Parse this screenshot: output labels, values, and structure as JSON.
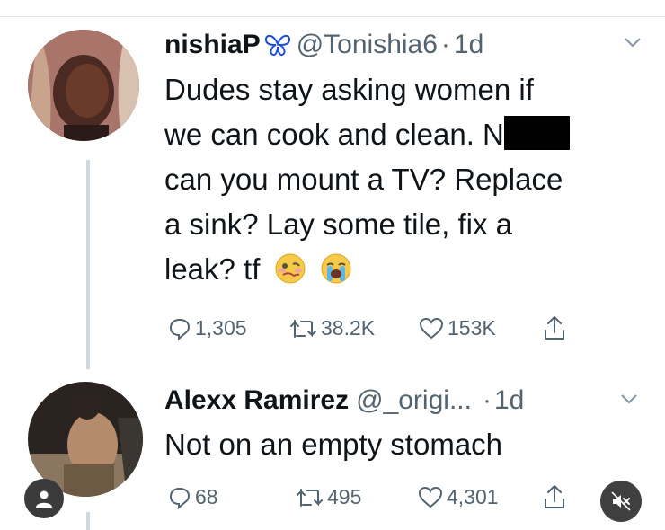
{
  "tweet1": {
    "display_name": "nishiaP",
    "handle": "@Tonishia6",
    "dot": "·",
    "time": "1d",
    "text_lines": [
      "Dudes stay asking women if",
      "we can cook and clean. N",
      "can you mount a TV? Replace",
      "a sink? Lay some tile, fix a",
      "leak? tf"
    ],
    "emojis": [
      "woozy-face",
      "loudly-crying-face"
    ],
    "replies": "1,305",
    "retweets": "38.2K",
    "likes": "153K"
  },
  "tweet2": {
    "display_name": "Alexx Ramirez",
    "handle": "@_origi...",
    "dot": "·",
    "time": "1d",
    "text": "Not on an empty stomach",
    "replies": "68",
    "retweets": "495",
    "likes": "4,301"
  },
  "icons": {
    "reply": "reply-icon",
    "retweet": "retweet-icon",
    "like": "heart-icon",
    "share": "share-icon",
    "more": "chevron-down-icon",
    "profile": "profile-icon",
    "mute": "muted-speaker-icon"
  },
  "colors": {
    "text": "#0f1419",
    "secondary": "#536471",
    "thread_line": "#cfd9de"
  }
}
